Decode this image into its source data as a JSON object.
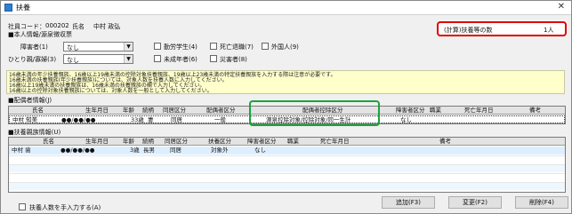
{
  "window": {
    "title": "扶養",
    "close": "✕"
  },
  "employee": {
    "code_label": "社員コード：",
    "code": "000202",
    "name_label": "氏名",
    "name": "中村 政弘"
  },
  "count_box": {
    "label": "(計算)扶養等の数",
    "value": "1人"
  },
  "personal": {
    "title": "■本人情報/源泉徴収票",
    "disability_label": "障害者(1)",
    "disability_value": "なし",
    "single_label": "ひとり親/寡婦(3)",
    "single_value": "なし",
    "checks": [
      "勤労学生(4)",
      "未成年者(6)",
      "死亡退職(7)",
      "災害者(8)",
      "外国人(9)"
    ]
  },
  "notice": [
    "16歳未満の年少扶養親族、16歳以上19歳未満の控除対象扶養親族、19歳以上23歳未満の特定扶養親族を入力する際は注意が必要です。",
    "16歳未満の扶養親族(年少扶養親族)については、対象人数を扶養人数に入力してください。",
    "16歳以上19歳未満の扶養親族は、16歳未満の扶養親族の欄で入力してください。",
    "16歳以上の控除対象扶養親族については、対象人数を一般として入力してください。"
  ],
  "spouse": {
    "title": "■配偶者情報(J)",
    "columns": [
      "氏名",
      "生年月日",
      "年齢",
      "続柄",
      "同居区分",
      "配偶者区分",
      "配偶者控除区分",
      "障害者区分",
      "職業",
      "死亡年月日",
      "備考"
    ],
    "rows": [
      [
        "中村 知美",
        "●●/●●/●●",
        "33歳",
        "妻",
        "同居",
        "一般",
        "源泉控除対象/控除対象/同一生計",
        "なし",
        "",
        "",
        ""
      ]
    ]
  },
  "dependents": {
    "title": "■扶養親族情報(U)",
    "columns": [
      "氏名",
      "生年月日",
      "年齢",
      "続柄",
      "同居区分",
      "扶養区分",
      "障害者区分",
      "職業",
      "死亡年月日",
      "備考"
    ],
    "rows": [
      [
        "中村 歯",
        "●●/●●/●●",
        "3歳",
        "長男",
        "同居",
        "対象外",
        "なし",
        "",
        "",
        ""
      ]
    ]
  },
  "footer": {
    "manual_label": "扶養人数を手入力する(A)",
    "add": "追加(F3)",
    "edit": "変更(F2)",
    "delete": "削除(F4)"
  }
}
